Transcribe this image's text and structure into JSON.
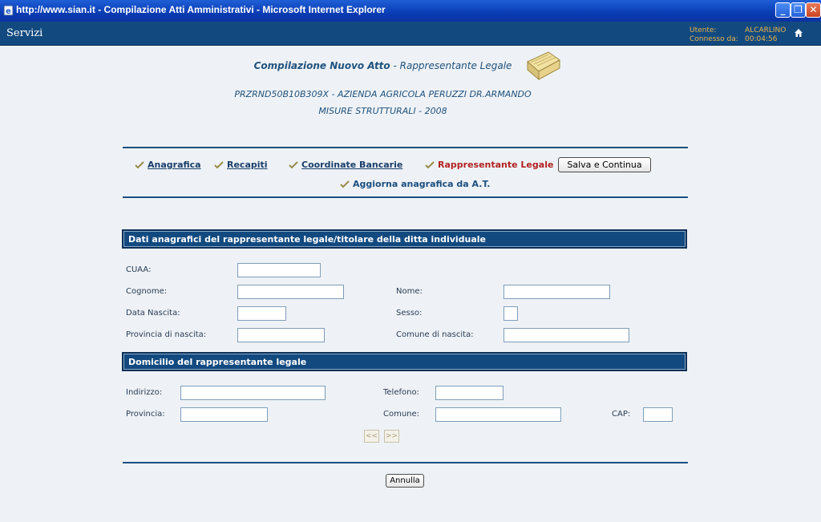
{
  "window": {
    "title": "http://www.sian.it - Compilazione Atti Amministrativi - Microsoft Internet Explorer"
  },
  "topbar": {
    "servizi": "Servizi",
    "utente_label": "Utente:",
    "utente_value": "ALCARLINO",
    "connesso_label": "Connesso da:",
    "connesso_value": "00:04:56"
  },
  "header": {
    "title_bold": "Compilazione Nuovo Atto",
    "title_sep": " - ",
    "title_sub": "Rappresentante Legale",
    "line1": "PRZRND50B10B309X - AZIENDA AGRICOLA PERUZZI DR.ARMANDO",
    "line2": "MISURE STRUTTURALI - 2008"
  },
  "nav": {
    "anagrafica": "Anagrafica",
    "recapiti": "Recapiti",
    "coordinate": "Coordinate Bancarie",
    "rappresentante": "Rappresentante Legale",
    "save": "Salva e Continua",
    "aggiorna": "Aggiorna anagrafica da A.T."
  },
  "section1": {
    "title": "Dati anagrafici del rappresentante legale/titolare della ditta individuale",
    "cuaa": "CUAA:",
    "cognome": "Cognome:",
    "nome": "Nome:",
    "data_nascita": "Data Nascita:",
    "sesso": "Sesso:",
    "provincia_nascita": "Provincia di nascita:",
    "comune_nascita": "Comune di nascita:"
  },
  "section2": {
    "title": "Domicilio del rappresentante legale",
    "indirizzo": "Indirizzo:",
    "telefono": "Telefono:",
    "provincia": "Provincia:",
    "comune": "Comune:",
    "cap": "CAP:"
  },
  "pager": {
    "prev": "<<",
    "next": ">>"
  },
  "footer": {
    "annulla": "Annulla"
  },
  "colors": {
    "header_blue": "#124a80",
    "active_red": "#b22222",
    "accent_orange": "#e8b24a"
  }
}
